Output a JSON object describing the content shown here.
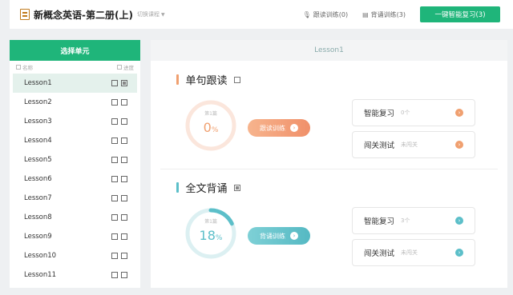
{
  "header": {
    "title": "新概念英语-第二册(上)",
    "switch_course": "切换课程",
    "follow_read": "跟读训练(0)",
    "recite": "背诵训练(3)",
    "review_all": "一键智能复习(3)"
  },
  "sidebar": {
    "title": "选择单元",
    "col_name": "名称",
    "col_progress": "进度",
    "lessons": [
      {
        "name": "Lesson1",
        "active": true
      },
      {
        "name": "Lesson2"
      },
      {
        "name": "Lesson3"
      },
      {
        "name": "Lesson4"
      },
      {
        "name": "Lesson5"
      },
      {
        "name": "Lesson6"
      },
      {
        "name": "Lesson7"
      },
      {
        "name": "Lesson8"
      },
      {
        "name": "Lesson9"
      },
      {
        "name": "Lesson10"
      },
      {
        "name": "Lesson11"
      }
    ]
  },
  "main": {
    "lesson_title": "Lesson1",
    "sentence": {
      "title": "单句跟读",
      "ring_label": "第1篇",
      "progress_value": "0",
      "progress_unit": "%",
      "progress_fraction": 0.0,
      "train_label": "跟读训练",
      "review_label": "智能复习",
      "review_meta": "0个",
      "test_label": "闯关测试",
      "test_meta": "未闯关",
      "accent": "#f0a070"
    },
    "fulltext": {
      "title": "全文背诵",
      "ring_label": "第1篇",
      "progress_value": "18",
      "progress_unit": "%",
      "progress_fraction": 0.18,
      "train_label": "背诵训练",
      "review_label": "智能复习",
      "review_meta": "3个",
      "test_label": "闯关测试",
      "test_meta": "未闯关",
      "accent": "#5cbfc9"
    }
  },
  "colors": {
    "brand_green": "#1fb57a",
    "orange": "#f0a070",
    "teal": "#5cbfc9"
  }
}
